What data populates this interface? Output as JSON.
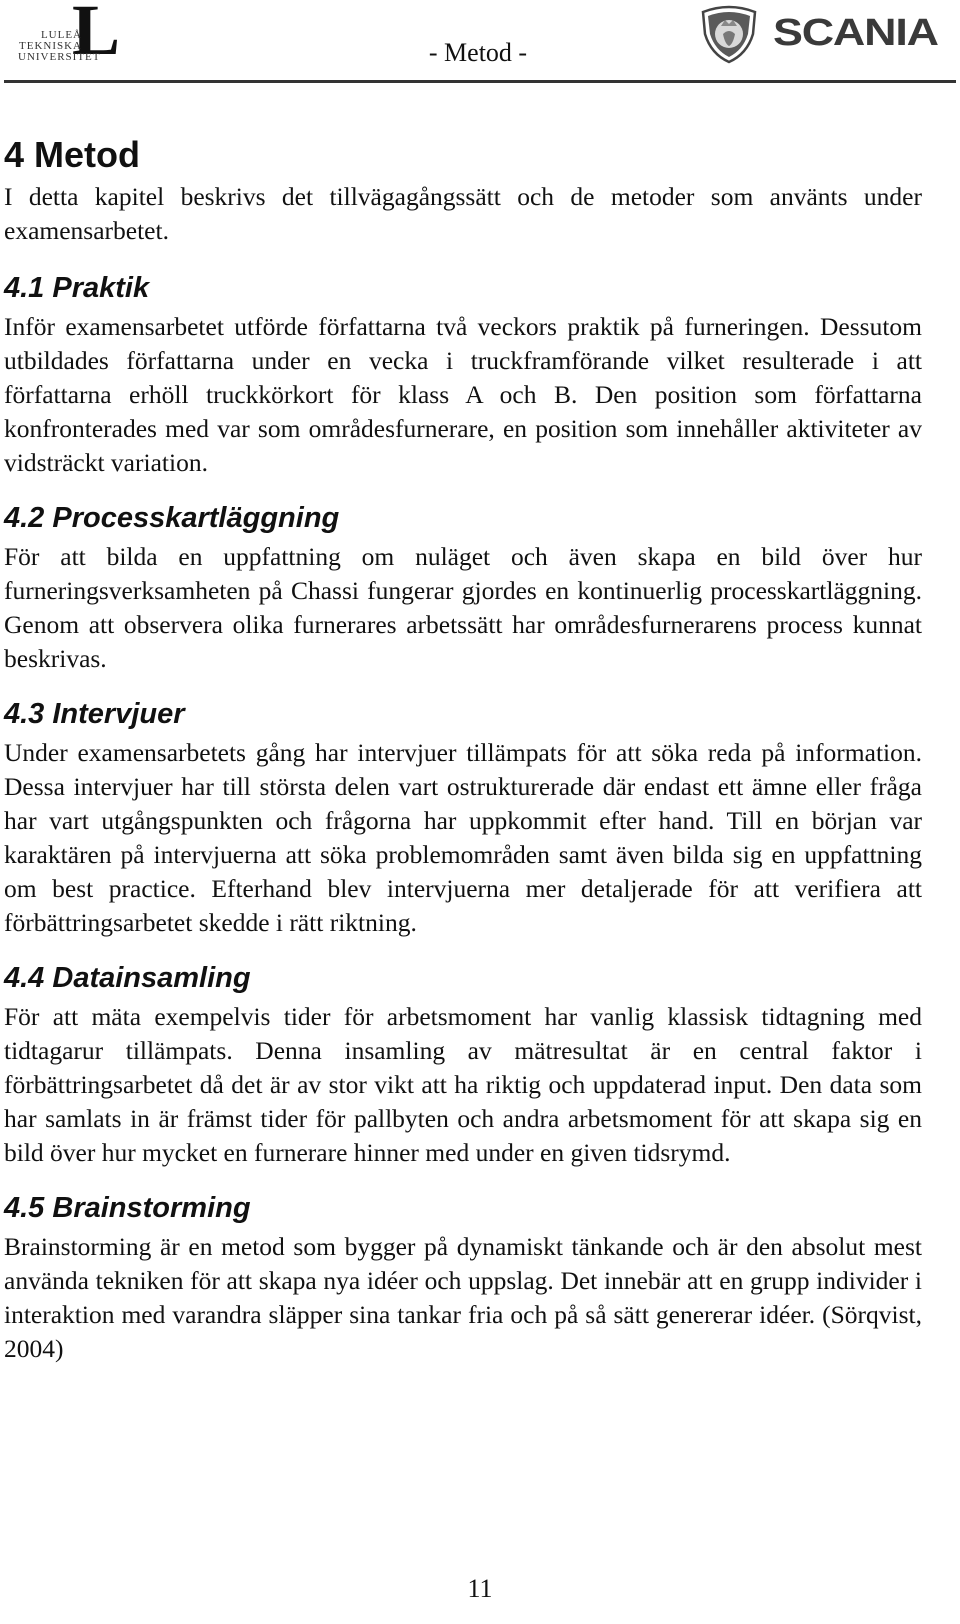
{
  "header": {
    "left_logo": {
      "name": "Luleå tekniska universitet",
      "lines": [
        "LULEÅ",
        "TEKNISKA",
        "UNIVERSITET"
      ],
      "monogram": "L"
    },
    "running_title": "- Metod -",
    "right_logo": {
      "wordmark": "SCANIA"
    }
  },
  "chapter": {
    "title": "4 Metod",
    "intro": "I detta kapitel beskrivs det tillvägagångssätt och de metoder som använts under examensarbetet."
  },
  "sections": [
    {
      "title": "4.1 Praktik",
      "body": "Inför examensarbetet utförde författarna två veckors praktik på furneringen. Dessutom utbildades författarna under en vecka i truckframförande vilket resulterade i att författarna erhöll truckkörkort för klass A och B. Den position som författarna konfronterades med var som områdesfurnerare, en position som innehåller aktiviteter av vidsträckt variation."
    },
    {
      "title": "4.2 Processkartläggning",
      "body": "För att bilda en uppfattning om nuläget och även skapa en bild över hur furneringsverksamheten på Chassi fungerar gjordes en kontinuerlig processkartläggning. Genom att observera olika furnerares arbetssätt har områdesfurnerarens process kunnat beskrivas."
    },
    {
      "title": "4.3 Intervjuer",
      "body": "Under examensarbetets gång har intervjuer tillämpats för att söka reda på information. Dessa intervjuer har till största delen vart ostrukturerade där endast ett ämne eller fråga har vart utgångspunkten och frågorna har uppkommit efter hand. Till en början var karaktären på intervjuerna att söka problemområden samt även bilda sig en uppfattning om best practice. Efterhand blev intervjuerna mer detaljerade för att verifiera att förbättringsarbetet skedde i rätt riktning."
    },
    {
      "title": "4.4 Datainsamling",
      "body": "För att mäta exempelvis tider för arbetsmoment har vanlig klassisk tidtagning med tidtagarur tillämpats. Denna insamling av mätresultat är en central faktor i förbättringsarbetet då det är av stor vikt att ha riktig och uppdaterad input. Den data som har samlats in är främst tider för pallbyten och andra arbetsmoment för att skapa sig en bild över hur mycket en furnerare hinner med under en given tidsrymd."
    },
    {
      "title": "4.5 Brainstorming",
      "body": "Brainstorming är en metod som bygger på dynamiskt tänkande och är den absolut mest använda tekniken för att skapa nya idéer och uppslag. Det innebär att en grupp individer i interaktion med varandra släpper sina tankar fria och på så sätt genererar idéer. (Sörqvist, 2004)"
    }
  ],
  "footer": {
    "page_number": "11"
  }
}
